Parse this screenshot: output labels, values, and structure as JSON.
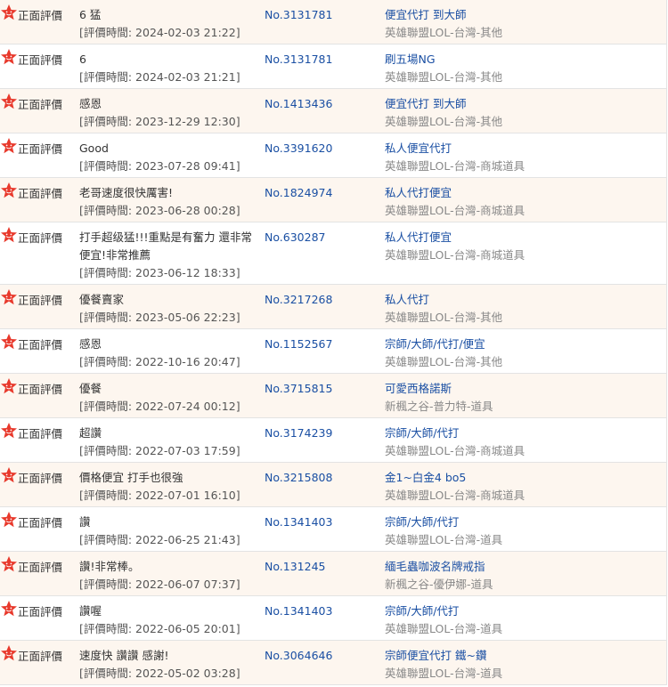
{
  "rating_label": "正面評價",
  "time_prefix": "[評價時間: ",
  "time_suffix": "]",
  "colors": {
    "order": "#1a4fa3",
    "category": "#888888",
    "row_alt": "#fdf6ef",
    "badge": "#e8392c"
  },
  "reviews": [
    {
      "comment": "6 猛",
      "time": "2024-02-03 21:22",
      "order": "No.3131781",
      "item": "便宜代打 到大師",
      "category": "英雄聯盟LOL-台灣-其他"
    },
    {
      "comment": "6",
      "time": "2024-02-03 21:21",
      "order": "No.3131781",
      "item": "刷五場NG",
      "category": "英雄聯盟LOL-台灣-其他"
    },
    {
      "comment": "感恩",
      "time": "2023-12-29 12:30",
      "order": "No.1413436",
      "item": "便宜代打 到大師",
      "category": "英雄聯盟LOL-台灣-其他"
    },
    {
      "comment": "Good",
      "time": "2023-07-28 09:41",
      "order": "No.3391620",
      "item": "私人便宜代打",
      "category": "英雄聯盟LOL-台灣-商城道具"
    },
    {
      "comment": "老哥速度很快厲害!",
      "time": "2023-06-28 00:28",
      "order": "No.1824974",
      "item": "私人代打便宜",
      "category": "英雄聯盟LOL-台灣-商城道具"
    },
    {
      "comment": "打手超级猛!!!重點是有奮力 還非常便宜!非常推薦",
      "time": "2023-06-12 18:33",
      "order": "No.630287",
      "item": "私人代打便宜",
      "category": "英雄聯盟LOL-台灣-商城道具"
    },
    {
      "comment": "優餐賣家",
      "time": "2023-05-06 22:23",
      "order": "No.3217268",
      "item": "私人代打",
      "category": "英雄聯盟LOL-台灣-其他"
    },
    {
      "comment": "感恩",
      "time": "2022-10-16 20:47",
      "order": "No.1152567",
      "item": "宗師/大師/代打/便宜",
      "category": "英雄聯盟LOL-台灣-其他"
    },
    {
      "comment": "優餐",
      "time": "2022-07-24 00:12",
      "order": "No.3715815",
      "item": "可愛西格諾斯",
      "category": "新楓之谷-普力特-道具"
    },
    {
      "comment": "超讚",
      "time": "2022-07-03 17:59",
      "order": "No.3174239",
      "item": "宗師/大師/代打",
      "category": "英雄聯盟LOL-台灣-商城道具"
    },
    {
      "comment": "價格便宜 打手也很強",
      "time": "2022-07-01 16:10",
      "order": "No.3215808",
      "item": "金1~白金4 bo5",
      "category": "英雄聯盟LOL-台灣-商城道具"
    },
    {
      "comment": "讚",
      "time": "2022-06-25 21:43",
      "order": "No.1341403",
      "item": "宗師/大師/代打",
      "category": "英雄聯盟LOL-台灣-道具"
    },
    {
      "comment": "讚!非常棒。",
      "time": "2022-06-07 07:37",
      "order": "No.131245",
      "item": "緬毛蟲咖波名牌戒指",
      "category": "新楓之谷-優伊娜-道具"
    },
    {
      "comment": "讚喔",
      "time": "2022-06-05 20:01",
      "order": "No.1341403",
      "item": "宗師/大師/代打",
      "category": "英雄聯盟LOL-台灣-道具"
    },
    {
      "comment": "速度快 讚讚 感謝!",
      "time": "2022-05-02 03:28",
      "order": "No.3064646",
      "item": "宗師便宜代打 鐵~鑽",
      "category": "英雄聯盟LOL-台灣-道具"
    }
  ]
}
